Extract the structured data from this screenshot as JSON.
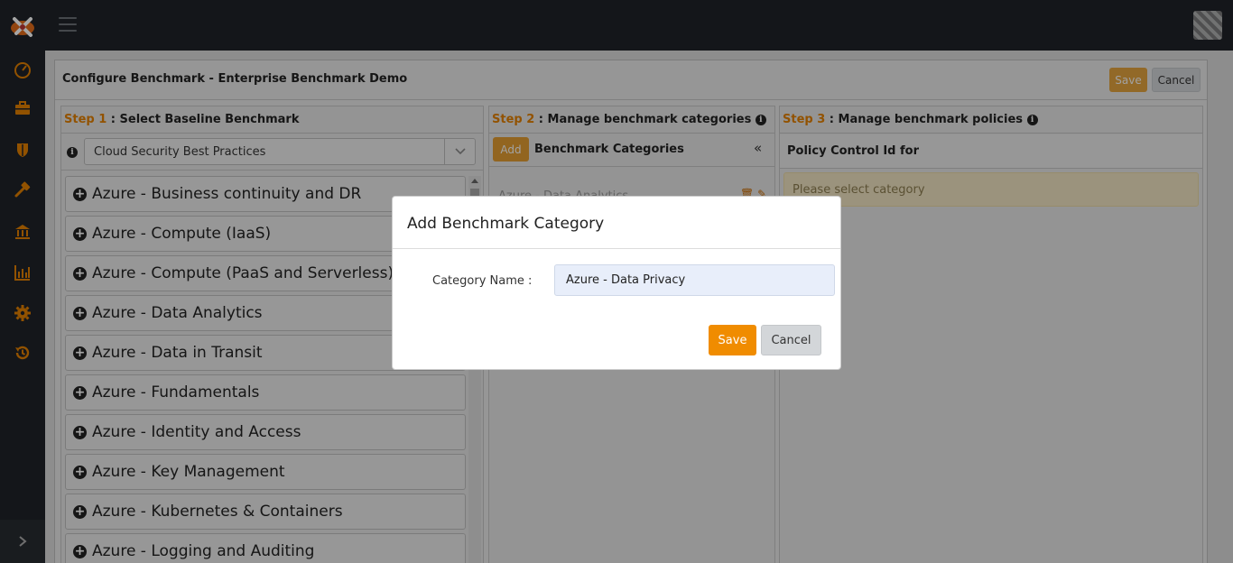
{
  "header": {
    "title": "Configure Benchmark - Enterprise Benchmark Demo",
    "save_label": "Save",
    "cancel_label": "Cancel"
  },
  "sidebar": {
    "icons": [
      "dashboard-icon",
      "briefcase-icon",
      "shield-icon",
      "hammer-icon",
      "bank-icon",
      "bar-chart-icon",
      "gear-icon",
      "history-icon"
    ],
    "expand_icon": "chevron-right-icon"
  },
  "step1": {
    "step_label": "Step 1",
    "heading": " : Select Baseline Benchmark",
    "selected_baseline": "Cloud Security Best Practices",
    "items": [
      "Azure - Business continuity and DR",
      "Azure - Compute (IaaS)",
      "Azure - Compute (PaaS and Serverless)",
      "Azure - Data Analytics",
      "Azure - Data in Transit",
      "Azure - Fundamentals",
      "Azure - Identity and Access",
      "Azure - Key Management",
      "Azure - Kubernetes & Containers",
      "Azure - Logging and Auditing"
    ]
  },
  "step2": {
    "step_label": "Step 2",
    "heading": " : Manage benchmark categories",
    "add_label": "Add",
    "categories_title": "Benchmark Categories",
    "category_item": "Azure - Data Analytics"
  },
  "step3": {
    "step_label": "Step 3",
    "heading": " : Manage benchmark policies",
    "policy_title": "Policy Control Id for",
    "empty_message": "Please select category"
  },
  "modal": {
    "title": "Add Benchmark Category",
    "field_label": "Category Name :",
    "field_value": "Azure - Data Privacy",
    "save_label": "Save",
    "cancel_label": "Cancel"
  },
  "colors": {
    "accent": "#f08c00",
    "sidebar_icon": "#e07f00",
    "topbar": "#1f2329"
  }
}
